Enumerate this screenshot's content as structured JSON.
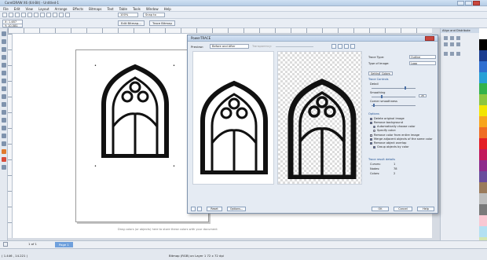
{
  "app": {
    "title": "CorelDRAW X6 (64-Bit) - Untitled-1",
    "menu": [
      "File",
      "Edit",
      "View",
      "Layout",
      "Arrange",
      "Effects",
      "Bitmaps",
      "Text",
      "Table",
      "Tools",
      "Window",
      "Help"
    ]
  },
  "toolbar": {
    "zoom": "100%",
    "snap_to": "Snap to",
    "edit_bitmap": "Edit Bitmap...",
    "trace_bitmap": "Trace Bitmap",
    "x_value": "X: 1.487",
    "y_value": "Y: 10.581"
  },
  "docker": {
    "title": "Align and Distribute"
  },
  "status": {
    "canvas_hint": "Drag colors (or objects) here to store these colors with your document",
    "selection_info": "Bitmap (RGB) on Layer 1 72 x 72 dpi",
    "coordinates": "( 1.446 , 14.221 )",
    "page_counter": "1 of 1",
    "page_tab": "Page 1"
  },
  "dialog": {
    "title": "PowerTRACE",
    "preview_label": "Preview:",
    "preview_value": "Before and After",
    "transparency_label": "Transparency:",
    "trace_type_label": "Trace Type:",
    "trace_type_value": "Outline",
    "image_type_label": "Type of Image:",
    "image_type_value": "Logo",
    "tabs": [
      "Settings",
      "Colors"
    ],
    "trace_controls": "Trace Controls",
    "detail_label": "Detail",
    "smoothing_label": "Smoothing",
    "smoothing_value": "25",
    "corner_label": "Corner smoothness",
    "options_label": "Options",
    "options": [
      {
        "label": "Delete original image",
        "checked": true
      },
      {
        "label": "Remove background",
        "checked": true
      },
      {
        "label": "Automatically choose color",
        "checked": true
      },
      {
        "label": "Specify color:",
        "checked": false
      },
      {
        "label": "Remove color from entire image",
        "checked": false
      },
      {
        "label": "Merge adjacent objects of the same color",
        "checked": true
      },
      {
        "label": "Remove object overlap",
        "checked": true
      },
      {
        "label": "Group objects by color",
        "checked": true
      }
    ],
    "results_label": "Trace result details",
    "curves_label": "Curves:",
    "curves_value": "1",
    "nodes_label": "Nodes:",
    "nodes_value": "78",
    "colors_label": "Colors:",
    "colors_value": "2",
    "reset_button": "Reset",
    "options_button": "Options...",
    "ok_button": "OK",
    "cancel_button": "Cancel",
    "help_button": "Help"
  },
  "colors": {
    "accent": "#6fa0dc",
    "palette": [
      "#ffffff",
      "#000000",
      "#1a3d8f",
      "#2f6fd0",
      "#27a0d6",
      "#33b24a",
      "#8cc63f",
      "#f2e500",
      "#f7a51c",
      "#ef6d23",
      "#e41e26",
      "#c2185b",
      "#8e2a8b",
      "#6a4c9c",
      "#9b7b5b",
      "#bdbdbd",
      "#7a7a7a",
      "#f9c8d3",
      "#b3e0f2",
      "#d3e6b0"
    ]
  }
}
